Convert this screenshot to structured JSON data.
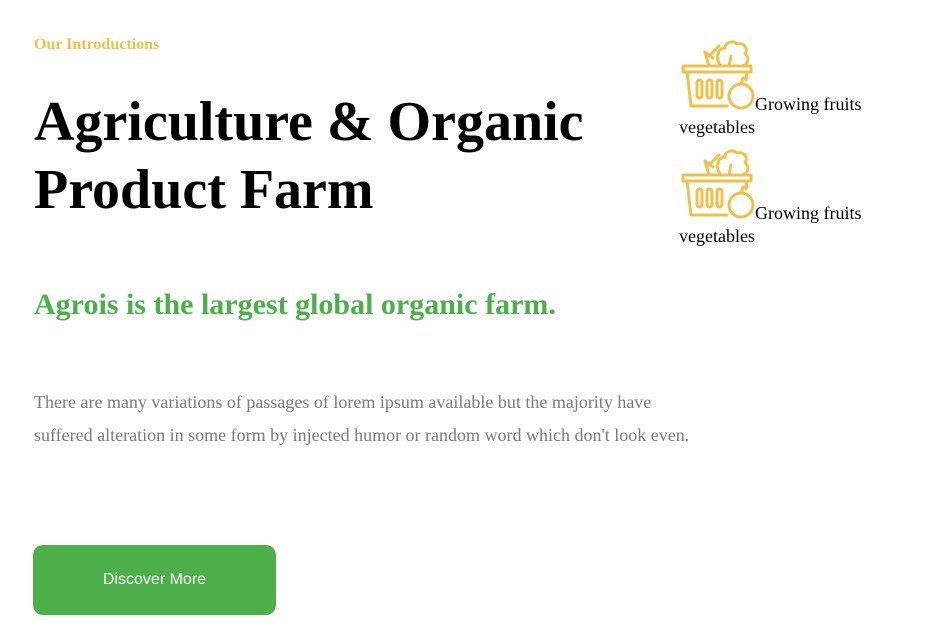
{
  "section": {
    "eyebrow": "Our Introductions",
    "title": "Agriculture & Organic Product Farm",
    "subtitle": "Agrois is the largest global organic farm.",
    "body": "There are many variations of passages of lorem ipsum available but the majority have suffered alteration in some form by injected humor or random word which don't look even.",
    "cta_label": "Discover More"
  },
  "features": [
    {
      "icon": "vegetable-basket-icon",
      "label": "Growing fruits vegetables"
    },
    {
      "icon": "vegetable-basket-icon",
      "label": "Growing fruits vegetables"
    }
  ],
  "colors": {
    "accent_yellow": "#eec14e",
    "brand_green": "#4caf4a",
    "body_gray": "#7a7a7a"
  }
}
